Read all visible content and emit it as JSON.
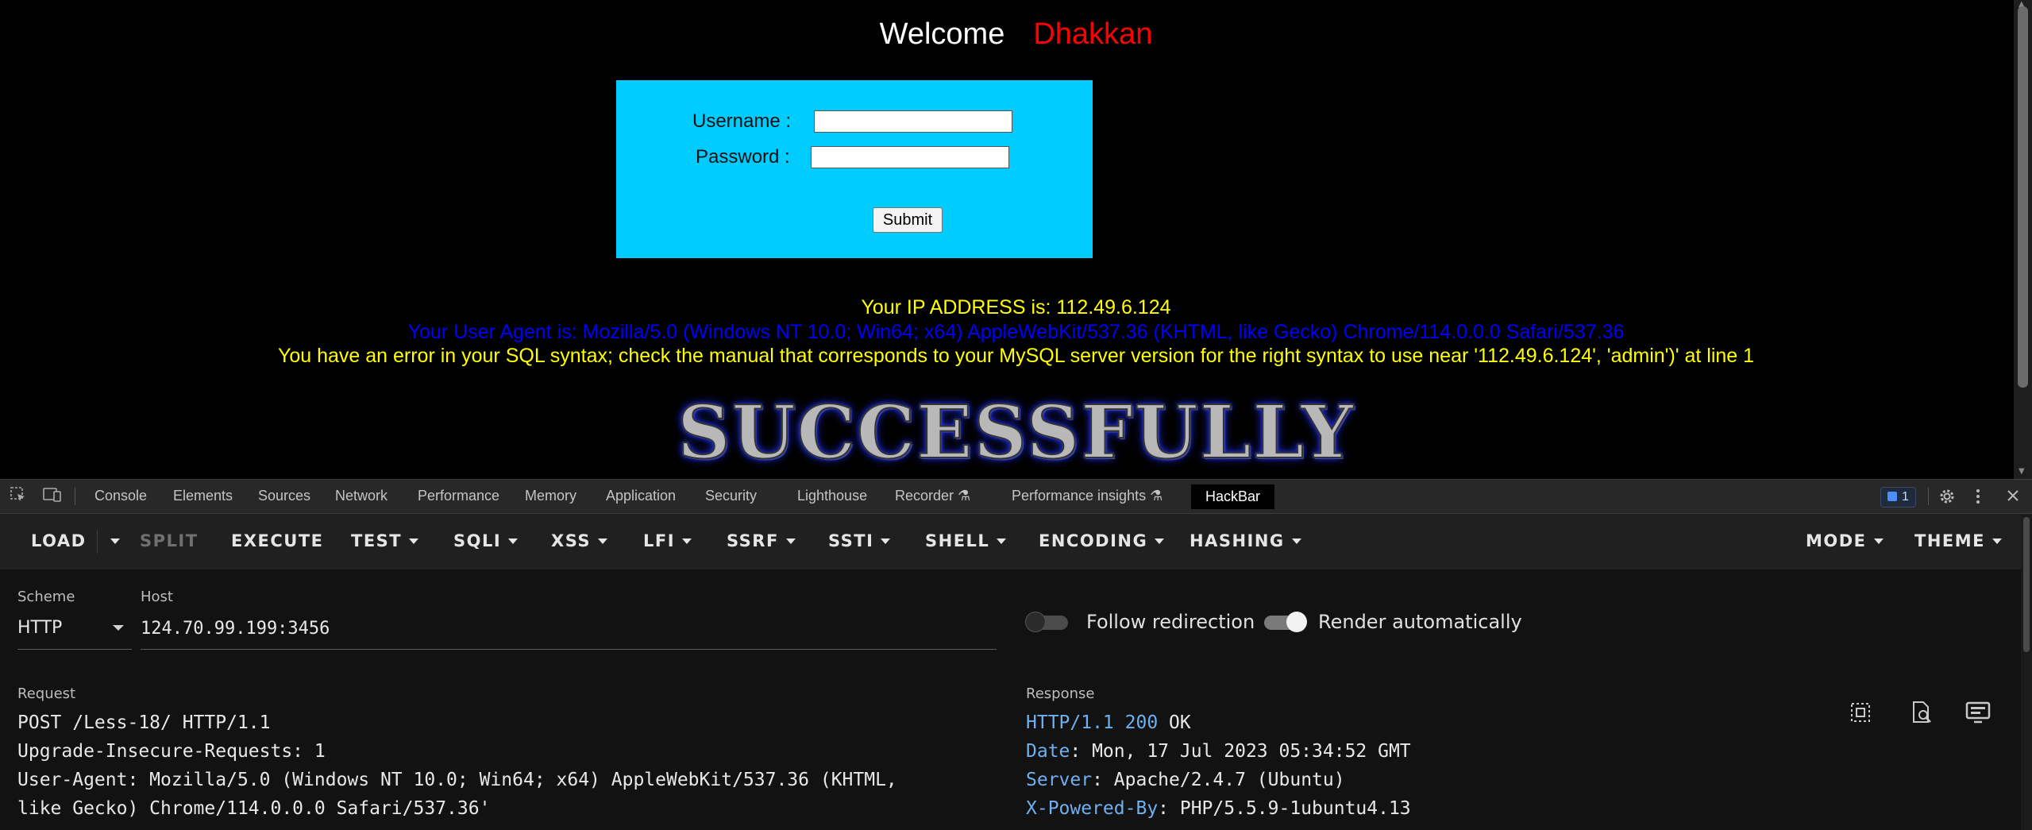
{
  "page": {
    "welcome": "Welcome",
    "user": "Dhakkan",
    "username_label": "Username :",
    "password_label": "Password :",
    "submit_label": "Submit",
    "ip_text": "Your IP ADDRESS is: 112.49.6.124",
    "ua_text": "Your User Agent is: Mozilla/5.0 (Windows NT 10.0; Win64; x64) AppleWebKit/537.36 (KHTML, like Gecko) Chrome/114.0.0.0 Safari/537.36",
    "error_text": "You have an error in your SQL syntax; check the manual that corresponds to your MySQL server version for the right syntax to use near '112.49.6.124', 'admin')' at line 1",
    "banner": "SUCCESSFULLY"
  },
  "devtools": {
    "tabs": [
      "Console",
      "Elements",
      "Sources",
      "Network",
      "Performance",
      "Memory",
      "Application",
      "Security",
      "Lighthouse",
      "Recorder",
      "Performance insights",
      "HackBar"
    ],
    "active_tab": "HackBar",
    "issues_count": "1"
  },
  "hackbar": {
    "toolbar": {
      "load": "LOAD",
      "split": "SPLIT",
      "execute": "EXECUTE",
      "test": "TEST",
      "sqli": "SQLI",
      "xss": "XSS",
      "lfi": "LFI",
      "ssrf": "SSRF",
      "ssti": "SSTI",
      "shell": "SHELL",
      "encoding": "ENCODING",
      "hashing": "HASHING",
      "mode": "MODE",
      "theme": "THEME"
    },
    "scheme_label": "Scheme",
    "scheme_value": "HTTP",
    "host_label": "Host",
    "host_value": "124.70.99.199:3456",
    "follow_redirection": "Follow redirection",
    "follow_redirection_on": false,
    "render_automatically": "Render automatically",
    "render_automatically_on": true,
    "request_label": "Request",
    "request_lines": [
      "POST /Less-18/ HTTP/1.1",
      "Upgrade-Insecure-Requests: 1",
      "User-Agent: Mozilla/5.0 (Windows NT 10.0; Win64; x64) AppleWebKit/537.36 (KHTML,",
      "like Gecko) Chrome/114.0.0.0 Safari/537.36'"
    ],
    "response_label": "Response",
    "response": {
      "status_proto": "HTTP/1.1",
      "status_code": "200",
      "status_text": "OK",
      "date_key": "Date",
      "date_val": ": Mon, 17 Jul 2023 05:34:52 GMT",
      "server_key": "Server",
      "server_val": ": Apache/2.4.7 (Ubuntu)",
      "powered_key": "X-Powered-By",
      "powered_val": ": PHP/5.5.9-1ubuntu4.13"
    }
  },
  "colors": {
    "login_bg": "#00ccff",
    "ip_color": "#ffff00",
    "ua_color": "#0000ff",
    "error_color": "#ffff00",
    "response_key_color": "#6fb0f0"
  }
}
